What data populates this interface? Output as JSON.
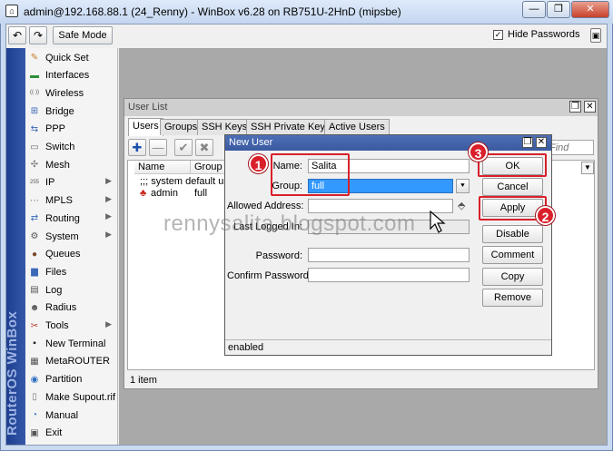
{
  "window": {
    "title": "admin@192.168.88.1 (24_Renny) - WinBox v6.28 on RB751U-2HnD (mipsbe)",
    "minimize_glyph": "—",
    "restore_glyph": "❐",
    "close_glyph": "✕"
  },
  "toolbar": {
    "undo_glyph": "↶",
    "redo_glyph": "↷",
    "safe_mode_label": "Safe Mode",
    "hide_passwords_label": "Hide Passwords",
    "hide_passwords_checked": "✓"
  },
  "sidebar": {
    "brand": "RouterOS WinBox",
    "items": [
      {
        "label": "Quick Set",
        "icon": "quickset-icon",
        "glyph": "✎",
        "color": "#c77c2a"
      },
      {
        "label": "Interfaces",
        "icon": "interfaces-icon",
        "glyph": "▬",
        "color": "#2f8f3a"
      },
      {
        "label": "Wireless",
        "icon": "wireless-icon",
        "glyph": "((·))",
        "color": "#555555"
      },
      {
        "label": "Bridge",
        "icon": "bridge-icon",
        "glyph": "⊞",
        "color": "#3b68b8"
      },
      {
        "label": "PPP",
        "icon": "ppp-icon",
        "glyph": "⇆",
        "color": "#3b68b8"
      },
      {
        "label": "Switch",
        "icon": "switch-icon",
        "glyph": "▭",
        "color": "#666666"
      },
      {
        "label": "Mesh",
        "icon": "mesh-icon",
        "glyph": "✣",
        "color": "#777777"
      },
      {
        "label": "IP",
        "icon": "ip-icon",
        "glyph": "255",
        "color": "#555555",
        "arrow": "▶"
      },
      {
        "label": "MPLS",
        "icon": "mpls-icon",
        "glyph": "⋯",
        "color": "#777777",
        "arrow": "▶"
      },
      {
        "label": "Routing",
        "icon": "routing-icon",
        "glyph": "⇄",
        "color": "#3b68b8",
        "arrow": "▶"
      },
      {
        "label": "System",
        "icon": "system-icon",
        "glyph": "⚙",
        "color": "#555555",
        "arrow": "▶"
      },
      {
        "label": "Queues",
        "icon": "queues-icon",
        "glyph": "●",
        "color": "#7a4a2a"
      },
      {
        "label": "Files",
        "icon": "files-icon",
        "glyph": "▆",
        "color": "#3b68b8"
      },
      {
        "label": "Log",
        "icon": "log-icon",
        "glyph": "▤",
        "color": "#555555"
      },
      {
        "label": "Radius",
        "icon": "radius-icon",
        "glyph": "☻",
        "color": "#555555"
      },
      {
        "label": "Tools",
        "icon": "tools-icon",
        "glyph": "✂",
        "color": "#b03a2a",
        "arrow": "▶"
      },
      {
        "label": "New Terminal",
        "icon": "terminal-icon",
        "glyph": "▪",
        "color": "#222222"
      },
      {
        "label": "MetaROUTER",
        "icon": "metarouter-icon",
        "glyph": "▦",
        "color": "#555555"
      },
      {
        "label": "Partition",
        "icon": "partition-icon",
        "glyph": "◉",
        "color": "#2a6fc0"
      },
      {
        "label": "Make Supout.rif",
        "icon": "supout-icon",
        "glyph": "▯",
        "color": "#777777"
      },
      {
        "label": "Manual",
        "icon": "manual-icon",
        "glyph": "◔",
        "color": "#2a6fc0"
      },
      {
        "label": "Exit",
        "icon": "exit-icon",
        "glyph": "▣",
        "color": "#555555"
      }
    ]
  },
  "user_list": {
    "title": "User List",
    "tabs": [
      "Users",
      "Groups",
      "SSH Keys",
      "SSH Private Keys",
      "Active Users"
    ],
    "find_placeholder": "Find",
    "add_glyph": "✚",
    "remove_glyph": "—",
    "enable_glyph": "✔",
    "disable_glyph": "✖",
    "columns": [
      "Name",
      "Group"
    ],
    "rows": [
      {
        "name": ";;; system default user",
        "group": ""
      },
      {
        "name": "admin",
        "group": "full"
      }
    ],
    "status": "1 item",
    "dropdown_glyph": "▼"
  },
  "new_user": {
    "title": "New User",
    "name_label": "Name:",
    "name_value": "Salita",
    "group_label": "Group:",
    "group_value": "full",
    "allowed_address_label": "Allowed Address:",
    "allowed_address_value": "",
    "last_logged_in_label": "Last Logged In:",
    "last_logged_in_value": "",
    "password_label": "Password:",
    "password_value": "",
    "confirm_password_label": "Confirm Password:",
    "confirm_password_value": "",
    "buttons": {
      "ok": "OK",
      "cancel": "Cancel",
      "apply": "Apply",
      "disable": "Disable",
      "comment": "Comment",
      "copy": "Copy",
      "remove": "Remove"
    },
    "status": "enabled",
    "group_dropdown_glyph": "⯆",
    "address_spin_glyph": "⬘"
  },
  "annotations": {
    "badge_1": "1",
    "badge_2": "2",
    "badge_3": "3",
    "watermark": "rennysalita.blogspot.com"
  },
  "colors": {
    "annotation_red": "#d9202a",
    "sidebar_blue": "#1e3f8f",
    "dialog_title_blue": "#3a5aa0",
    "selection_blue": "#3399ff"
  }
}
